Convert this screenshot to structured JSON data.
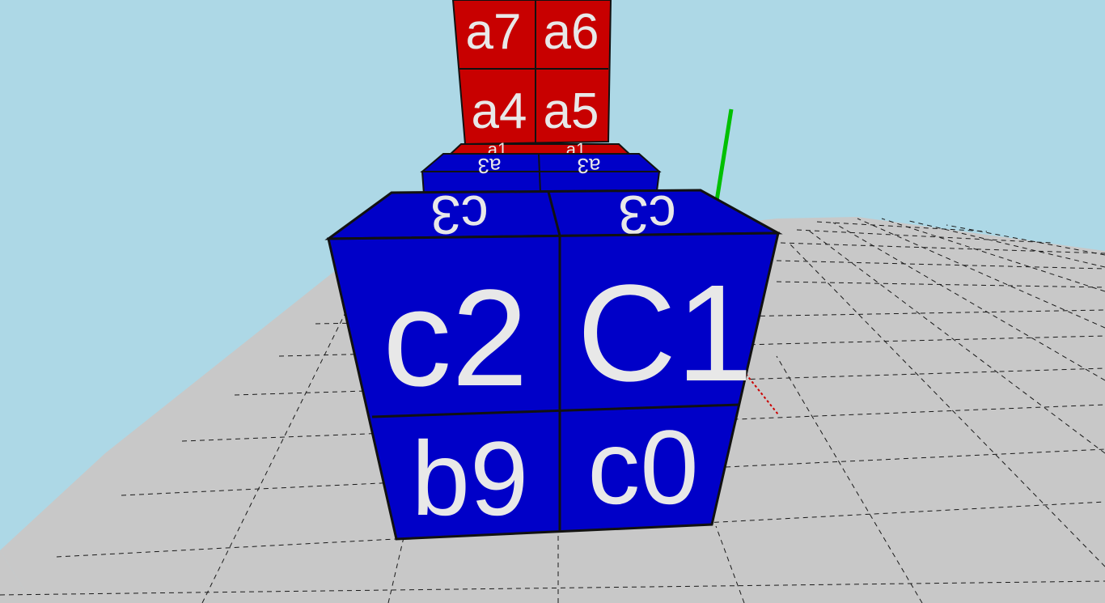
{
  "scene": {
    "colors": {
      "sky": "#add8e6",
      "floor": "#c8c8c8",
      "grid_line": "#1a1a1a",
      "blue_face": "#0000c8",
      "red_face": "#c80000",
      "label": "#e8e8e8",
      "y_axis": "#00c000",
      "x_axis": "#cc0000"
    },
    "front_cube": {
      "front_labels": [
        "c2",
        "C1",
        "b9",
        "c0"
      ],
      "top_labels": [
        "c3",
        "c3"
      ]
    },
    "middle_cube": {
      "top_labels": [
        "a3",
        "a3"
      ]
    },
    "back_tower": {
      "labels": [
        "a7",
        "a6",
        "a4",
        "a5"
      ],
      "edge_labels": [
        "a1",
        "a1"
      ]
    }
  }
}
